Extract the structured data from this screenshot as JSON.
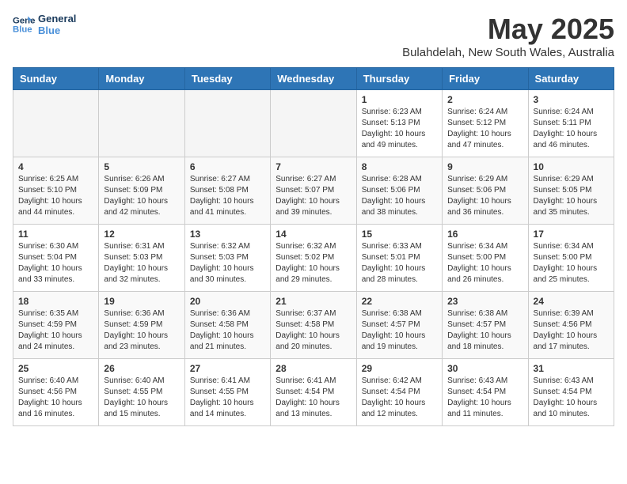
{
  "logo": {
    "general": "General",
    "blue": "Blue"
  },
  "header": {
    "title": "May 2025",
    "subtitle": "Bulahdelah, New South Wales, Australia"
  },
  "weekdays": [
    "Sunday",
    "Monday",
    "Tuesday",
    "Wednesday",
    "Thursday",
    "Friday",
    "Saturday"
  ],
  "weeks": [
    [
      {
        "day": "",
        "info": ""
      },
      {
        "day": "",
        "info": ""
      },
      {
        "day": "",
        "info": ""
      },
      {
        "day": "",
        "info": ""
      },
      {
        "day": "1",
        "info": "Sunrise: 6:23 AM\nSunset: 5:13 PM\nDaylight: 10 hours\nand 49 minutes."
      },
      {
        "day": "2",
        "info": "Sunrise: 6:24 AM\nSunset: 5:12 PM\nDaylight: 10 hours\nand 47 minutes."
      },
      {
        "day": "3",
        "info": "Sunrise: 6:24 AM\nSunset: 5:11 PM\nDaylight: 10 hours\nand 46 minutes."
      }
    ],
    [
      {
        "day": "4",
        "info": "Sunrise: 6:25 AM\nSunset: 5:10 PM\nDaylight: 10 hours\nand 44 minutes."
      },
      {
        "day": "5",
        "info": "Sunrise: 6:26 AM\nSunset: 5:09 PM\nDaylight: 10 hours\nand 42 minutes."
      },
      {
        "day": "6",
        "info": "Sunrise: 6:27 AM\nSunset: 5:08 PM\nDaylight: 10 hours\nand 41 minutes."
      },
      {
        "day": "7",
        "info": "Sunrise: 6:27 AM\nSunset: 5:07 PM\nDaylight: 10 hours\nand 39 minutes."
      },
      {
        "day": "8",
        "info": "Sunrise: 6:28 AM\nSunset: 5:06 PM\nDaylight: 10 hours\nand 38 minutes."
      },
      {
        "day": "9",
        "info": "Sunrise: 6:29 AM\nSunset: 5:06 PM\nDaylight: 10 hours\nand 36 minutes."
      },
      {
        "day": "10",
        "info": "Sunrise: 6:29 AM\nSunset: 5:05 PM\nDaylight: 10 hours\nand 35 minutes."
      }
    ],
    [
      {
        "day": "11",
        "info": "Sunrise: 6:30 AM\nSunset: 5:04 PM\nDaylight: 10 hours\nand 33 minutes."
      },
      {
        "day": "12",
        "info": "Sunrise: 6:31 AM\nSunset: 5:03 PM\nDaylight: 10 hours\nand 32 minutes."
      },
      {
        "day": "13",
        "info": "Sunrise: 6:32 AM\nSunset: 5:03 PM\nDaylight: 10 hours\nand 30 minutes."
      },
      {
        "day": "14",
        "info": "Sunrise: 6:32 AM\nSunset: 5:02 PM\nDaylight: 10 hours\nand 29 minutes."
      },
      {
        "day": "15",
        "info": "Sunrise: 6:33 AM\nSunset: 5:01 PM\nDaylight: 10 hours\nand 28 minutes."
      },
      {
        "day": "16",
        "info": "Sunrise: 6:34 AM\nSunset: 5:00 PM\nDaylight: 10 hours\nand 26 minutes."
      },
      {
        "day": "17",
        "info": "Sunrise: 6:34 AM\nSunset: 5:00 PM\nDaylight: 10 hours\nand 25 minutes."
      }
    ],
    [
      {
        "day": "18",
        "info": "Sunrise: 6:35 AM\nSunset: 4:59 PM\nDaylight: 10 hours\nand 24 minutes."
      },
      {
        "day": "19",
        "info": "Sunrise: 6:36 AM\nSunset: 4:59 PM\nDaylight: 10 hours\nand 23 minutes."
      },
      {
        "day": "20",
        "info": "Sunrise: 6:36 AM\nSunset: 4:58 PM\nDaylight: 10 hours\nand 21 minutes."
      },
      {
        "day": "21",
        "info": "Sunrise: 6:37 AM\nSunset: 4:58 PM\nDaylight: 10 hours\nand 20 minutes."
      },
      {
        "day": "22",
        "info": "Sunrise: 6:38 AM\nSunset: 4:57 PM\nDaylight: 10 hours\nand 19 minutes."
      },
      {
        "day": "23",
        "info": "Sunrise: 6:38 AM\nSunset: 4:57 PM\nDaylight: 10 hours\nand 18 minutes."
      },
      {
        "day": "24",
        "info": "Sunrise: 6:39 AM\nSunset: 4:56 PM\nDaylight: 10 hours\nand 17 minutes."
      }
    ],
    [
      {
        "day": "25",
        "info": "Sunrise: 6:40 AM\nSunset: 4:56 PM\nDaylight: 10 hours\nand 16 minutes."
      },
      {
        "day": "26",
        "info": "Sunrise: 6:40 AM\nSunset: 4:55 PM\nDaylight: 10 hours\nand 15 minutes."
      },
      {
        "day": "27",
        "info": "Sunrise: 6:41 AM\nSunset: 4:55 PM\nDaylight: 10 hours\nand 14 minutes."
      },
      {
        "day": "28",
        "info": "Sunrise: 6:41 AM\nSunset: 4:54 PM\nDaylight: 10 hours\nand 13 minutes."
      },
      {
        "day": "29",
        "info": "Sunrise: 6:42 AM\nSunset: 4:54 PM\nDaylight: 10 hours\nand 12 minutes."
      },
      {
        "day": "30",
        "info": "Sunrise: 6:43 AM\nSunset: 4:54 PM\nDaylight: 10 hours\nand 11 minutes."
      },
      {
        "day": "31",
        "info": "Sunrise: 6:43 AM\nSunset: 4:54 PM\nDaylight: 10 hours\nand 10 minutes."
      }
    ]
  ]
}
